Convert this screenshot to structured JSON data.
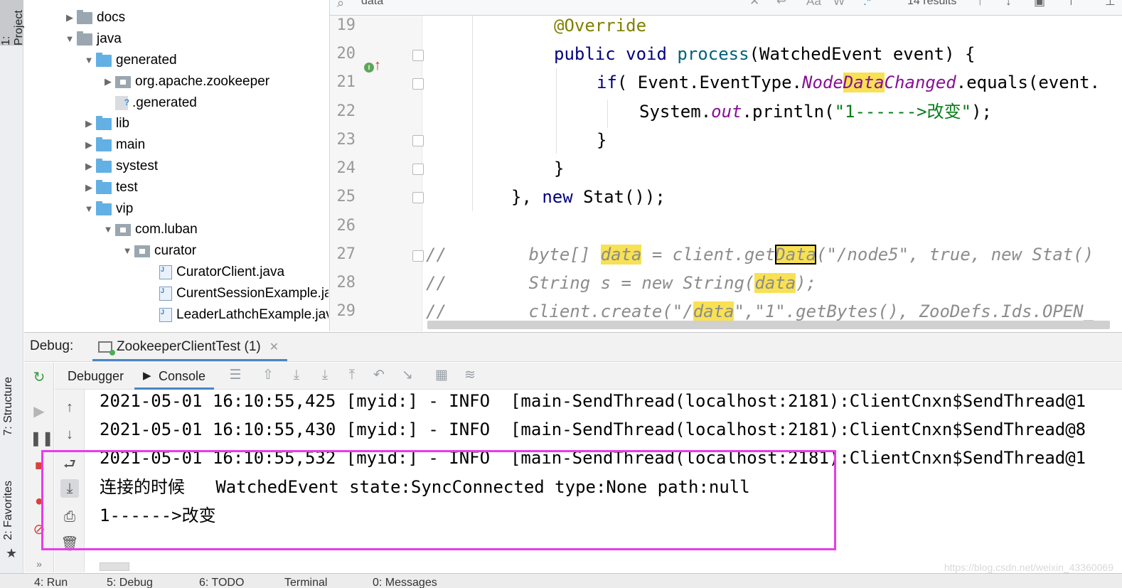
{
  "left_strip": {
    "project_tab": "1: Project",
    "structure_tab": "7: Structure",
    "favorites_tab": "2: Favorites"
  },
  "tree": {
    "items": [
      {
        "label": "docs",
        "icon": "folder-icon"
      },
      {
        "label": "java",
        "icon": "folder-icon"
      },
      {
        "label": "generated",
        "icon": "source-folder-icon"
      },
      {
        "label": "org.apache.zookeeper",
        "icon": "package-icon"
      },
      {
        "label": ".generated",
        "icon": "unknown-file-icon"
      },
      {
        "label": "lib",
        "icon": "source-folder-icon"
      },
      {
        "label": "main",
        "icon": "source-folder-icon"
      },
      {
        "label": "systest",
        "icon": "source-folder-icon"
      },
      {
        "label": "test",
        "icon": "source-folder-icon"
      },
      {
        "label": "vip",
        "icon": "source-folder-icon"
      },
      {
        "label": "com.luban",
        "icon": "package-icon"
      },
      {
        "label": "curator",
        "icon": "package-icon"
      },
      {
        "label": "CuratorClient.java",
        "icon": "java-file-icon"
      },
      {
        "label": "CurentSessionExample.java",
        "icon": "java-file-icon"
      },
      {
        "label": "LeaderLathchExample.java",
        "icon": "java-file-icon"
      }
    ]
  },
  "search": {
    "query": "data",
    "results": "14 results",
    "match_case": "Aa",
    "words": "W"
  },
  "editor": {
    "line_numbers": [
      "19",
      "20",
      "21",
      "22",
      "23",
      "24",
      "25",
      "26",
      "27",
      "28",
      "29"
    ],
    "lines": {
      "l19": {
        "ann": "@Override"
      },
      "l20": {
        "kw1": "public",
        "kw2": "void",
        "fn": "process",
        "rest": "(WatchedEvent event) {"
      },
      "l21": {
        "kw": "if",
        "a": "( Event.EventType.",
        "fld1": "Node",
        "hl": "Data",
        "fld2": "Changed",
        "rest": ".equals(event."
      },
      "l22": {
        "a": "System.",
        "fld": "out",
        "b": ".println(",
        "str": "\"1------>改变\"",
        "c": ");"
      },
      "l23": {
        "a": "}"
      },
      "l24": {
        "a": "}"
      },
      "l25": {
        "a": "}, ",
        "kw": "new",
        "b": " Stat());"
      },
      "l27": {
        "c1": "//        byte[] ",
        "hl1": "data",
        "c2": " = client.get",
        "hl2": "Data",
        "c3": "(\"/node5\", true, new Stat()"
      },
      "l28": {
        "c1": "//        String s = new String(",
        "hl1": "data",
        "c2": ");"
      },
      "l29": {
        "c1": "//        client.create(\"/",
        "hl1": "data",
        "c2": "\",\"1\".getBytes(), ZooDefs.Ids.OPEN_"
      }
    }
  },
  "debug": {
    "label": "Debug:",
    "session_tab": "ZookeeperClientTest (1)",
    "tabs": {
      "debugger": "Debugger",
      "console": "Console"
    }
  },
  "console": {
    "lines": [
      "2021-05-01 16:10:55,425 [myid:] - INFO  [main-SendThread(localhost:2181):ClientCnxn$SendThread@1",
      "2021-05-01 16:10:55,430 [myid:] - INFO  [main-SendThread(localhost:2181):ClientCnxn$SendThread@8",
      "2021-05-01 16:10:55,532 [myid:] - INFO  [main-SendThread(localhost:2181):ClientCnxn$SendThread@1",
      "连接的时候   WatchedEvent state:SyncConnected type:None path:null",
      "1------>改变"
    ]
  },
  "status_bar": {
    "item1": "4: Run",
    "item2": "5: Debug",
    "item3": "6: TODO",
    "item4": "Terminal",
    "item5": "0: Messages"
  },
  "watermark": "https://blog.csdn.net/weixin_43360069",
  "colors": {
    "highlight_box": "#e83ce8",
    "search_match": "#f8e152",
    "keyword": "#000080",
    "string": "#067d17",
    "field": "#871094",
    "comment": "#8c8c8c"
  }
}
